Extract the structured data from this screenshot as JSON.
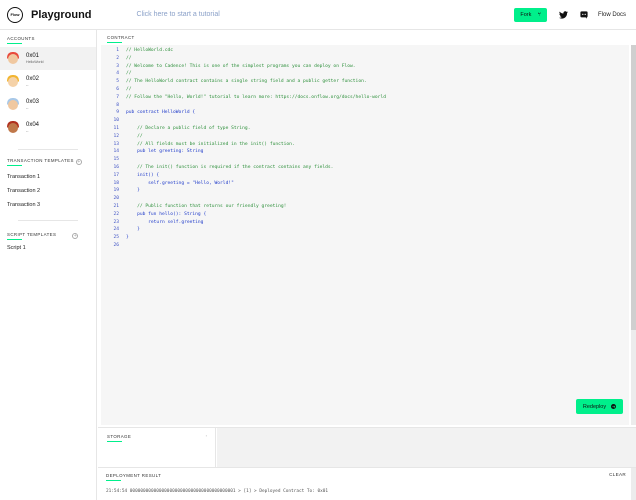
{
  "header": {
    "logo_text": "Flow",
    "title": "Playground",
    "tutorial_link": "Click here to start a tutorial",
    "fork_label": "Fork",
    "docs_label": "Flow Docs"
  },
  "sidebar": {
    "accounts_title": "ACCOUNTS",
    "accounts": [
      {
        "name": "0x01",
        "sub": "HelloWorld",
        "face": "#f0c8a0",
        "hair": "#e84a3c"
      },
      {
        "name": "0x02",
        "sub": "--",
        "face": "#f5d2a8",
        "hair": "#f2b531"
      },
      {
        "name": "0x03",
        "sub": "--",
        "face": "#f0c8a0",
        "hair": "#a8c8e8"
      },
      {
        "name": "0x04",
        "sub": "--",
        "face": "#c0784a",
        "hair": "#b0301f"
      }
    ],
    "tx_title": "TRANSACTION TEMPLATES",
    "transactions": [
      "Transaction 1",
      "Transaction 2",
      "Transaction 3"
    ],
    "script_title": "SCRIPT TEMPLATES",
    "scripts": [
      "Script 1"
    ]
  },
  "editor": {
    "label": "CONTRACT",
    "lines": [
      {
        "n": "1",
        "t": "// HelloWorld.cdc",
        "c": "comment"
      },
      {
        "n": "2",
        "t": "//",
        "c": "comment"
      },
      {
        "n": "3",
        "t": "// Welcome to Cadence! This is one of the simplest programs you can deploy on Flow.",
        "c": "comment"
      },
      {
        "n": "4",
        "t": "//",
        "c": "comment"
      },
      {
        "n": "5",
        "t": "// The HelloWorld contract contains a single string field and a public getter function.",
        "c": "comment"
      },
      {
        "n": "6",
        "t": "//",
        "c": "comment"
      },
      {
        "n": "7",
        "t": "// Follow the \"Hello, World!\" tutorial to learn more: https://docs.onflow.org/docs/hello-world",
        "c": "comment"
      },
      {
        "n": "8",
        "t": "",
        "c": ""
      },
      {
        "n": "9",
        "t": "pub contract HelloWorld {",
        "c": "kw"
      },
      {
        "n": "10",
        "t": "",
        "c": ""
      },
      {
        "n": "11",
        "t": "    // Declare a public field of type String.",
        "c": "comment"
      },
      {
        "n": "12",
        "t": "    //",
        "c": "comment"
      },
      {
        "n": "13",
        "t": "    // All fields must be initialized in the init() function.",
        "c": "comment"
      },
      {
        "n": "14",
        "t": "    pub let greeting: String",
        "c": "kw"
      },
      {
        "n": "15",
        "t": "",
        "c": ""
      },
      {
        "n": "16",
        "t": "    // The init() function is required if the contract contains any fields.",
        "c": "comment"
      },
      {
        "n": "17",
        "t": "    init() {",
        "c": "kw"
      },
      {
        "n": "18",
        "t": "        self.greeting = \"Hello, World!\"",
        "c": "kw"
      },
      {
        "n": "19",
        "t": "    }",
        "c": "kw"
      },
      {
        "n": "20",
        "t": "",
        "c": ""
      },
      {
        "n": "21",
        "t": "    // Public function that returns our friendly greeting!",
        "c": "comment"
      },
      {
        "n": "22",
        "t": "    pub fun hello(): String {",
        "c": "kw"
      },
      {
        "n": "23",
        "t": "        return self.greeting",
        "c": "kw"
      },
      {
        "n": "24",
        "t": "    }",
        "c": "kw"
      },
      {
        "n": "25",
        "t": "}",
        "c": "kw"
      },
      {
        "n": "26",
        "t": "",
        "c": ""
      }
    ],
    "redeploy_label": "Redeploy"
  },
  "storage": {
    "label": "STORAGE"
  },
  "deployment": {
    "label": "DEPLOYMENT RESULT",
    "clear_label": "CLEAR",
    "log": "21:54:54 0000000000000000000000000000000000000001 > [1] > Deployed Contract To: 0x01"
  }
}
